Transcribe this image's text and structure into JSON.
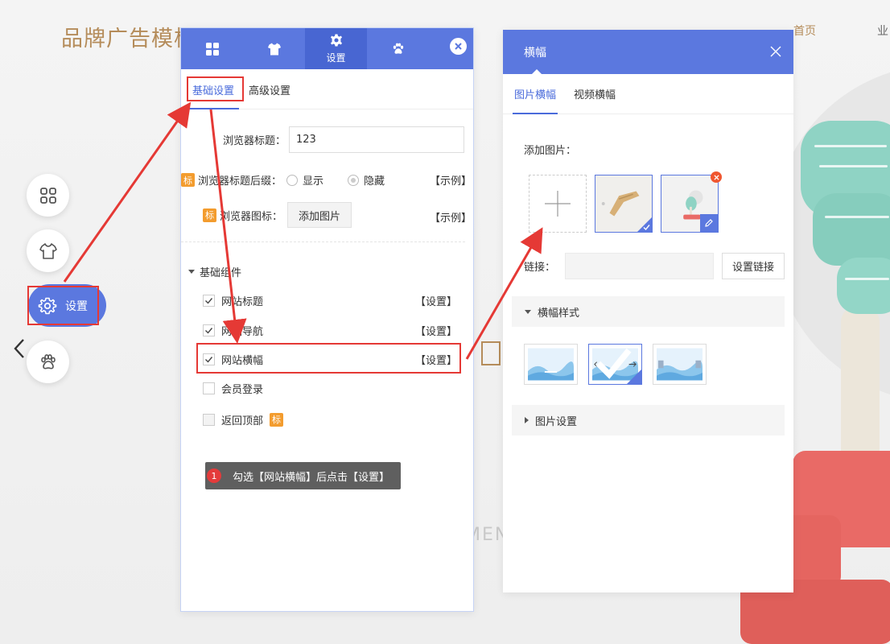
{
  "background": {
    "logo_text": "品牌广告模板",
    "nav": [
      "首页",
      "业"
    ],
    "watermark": "MEN"
  },
  "float_toolbar": {
    "active_label": "设置"
  },
  "settings_panel": {
    "header_tabs": [
      {
        "icon": "grid-icon",
        "label": ""
      },
      {
        "icon": "shirt-icon",
        "label": ""
      },
      {
        "icon": "gear-icon",
        "label": "设置"
      },
      {
        "icon": "paw-icon",
        "label": ""
      }
    ],
    "sub_tabs": [
      "基础设置",
      "高级设置"
    ],
    "browser_title_label": "浏览器标题：",
    "browser_title_value": "123",
    "title_suffix_badge": "标",
    "title_suffix_label": "浏览器标题后缀：",
    "suffix_options": [
      "显示",
      "隐藏"
    ],
    "suffix_selected": "隐藏",
    "example_label": "【示例】",
    "browser_icon_badge": "标",
    "browser_icon_label": "浏览器图标：",
    "add_image_button": "添加图片",
    "section_title": "基础组件",
    "components": [
      {
        "label": "网站标题",
        "checked": true,
        "action": "【设置】"
      },
      {
        "label": "网站导航",
        "checked": true,
        "action": "【设置】"
      },
      {
        "label": "网站横幅",
        "checked": true,
        "action": "【设置】"
      },
      {
        "label": "会员登录",
        "checked": false,
        "action": ""
      },
      {
        "label": "返回顶部",
        "checked": false,
        "action": "",
        "badge": "标"
      }
    ],
    "tooltip_step": "1",
    "tooltip_text": "勾选【网站横幅】后点击【设置】"
  },
  "banner_panel": {
    "title": "横幅",
    "tabs": [
      "图片横幅",
      "视频横幅"
    ],
    "add_image_label": "添加图片：",
    "link_label": "链接：",
    "set_link_button": "设置链接",
    "style_section": "横幅样式",
    "image_settings_section": "图片设置"
  },
  "colors": {
    "primary": "#5b78df",
    "annotation_red": "#e53935",
    "badge_orange": "#f39c2e",
    "brand_gold": "#b58c5a"
  }
}
